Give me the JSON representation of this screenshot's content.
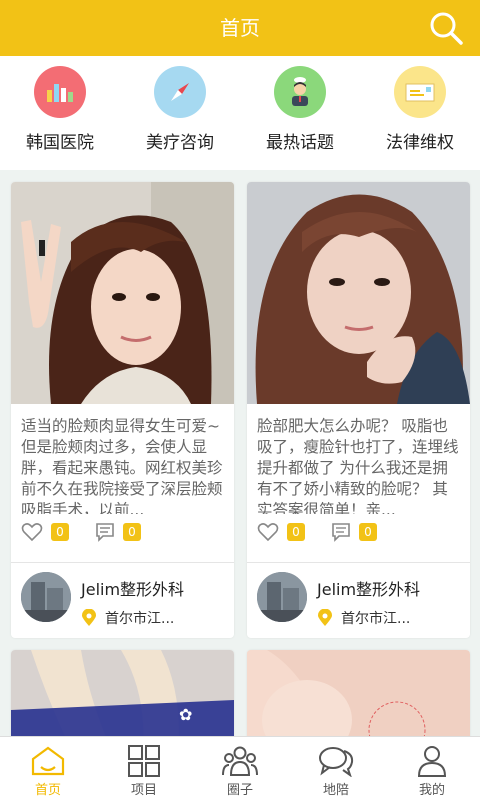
{
  "header": {
    "title": "首页",
    "search_icon": "search-icon"
  },
  "categories": [
    {
      "label": "韩国医院",
      "icon": "bar-chart-icon",
      "color": "#f36d74"
    },
    {
      "label": "美疗咨询",
      "icon": "compass-icon",
      "color": "#a6d9f1"
    },
    {
      "label": "最热话题",
      "icon": "person-icon",
      "color": "#8bd87b"
    },
    {
      "label": "法律维权",
      "icon": "envelope-icon",
      "color": "#fbe58a"
    }
  ],
  "posts": [
    {
      "text": "适当的脸颊肉显得女生可爱~但是脸颊肉过多，会使人显胖，看起来愚钝。网红权美珍前不久在我院接受了深层脸颊吸脂手术，以前...",
      "likes": "0",
      "comments": "0",
      "shop_name": "Jelim整形外科",
      "location": "首尔市江..."
    },
    {
      "text": "脸部肥大怎么办呢？ 吸脂也吸了，瘦脸针也打了，连埋线提升都做了 为什么我还是拥有不了娇小精致的脸呢？ 其实答案很简单！亲...",
      "likes": "0",
      "comments": "0",
      "shop_name": "Jelim整形外科",
      "location": "首尔市江..."
    }
  ],
  "tabs": [
    {
      "label": "首页",
      "icon": "home-icon",
      "active": true
    },
    {
      "label": "项目",
      "icon": "grid-icon",
      "active": false
    },
    {
      "label": "圈子",
      "icon": "group-icon",
      "active": false
    },
    {
      "label": "地陪",
      "icon": "chat-icon",
      "active": false
    },
    {
      "label": "我的",
      "icon": "user-icon",
      "active": false
    }
  ],
  "colors": {
    "accent": "#f2c216",
    "active_tab": "#f2b900",
    "background": "#eef3f1"
  }
}
